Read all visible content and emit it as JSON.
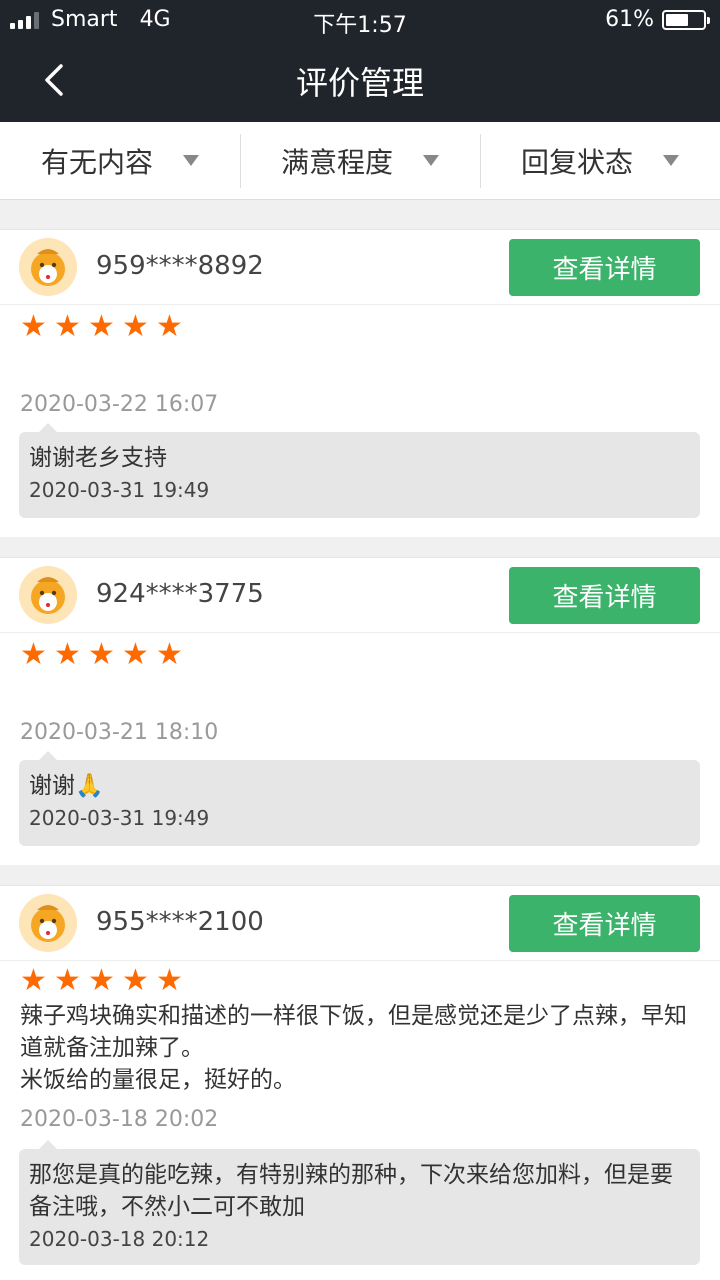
{
  "status_bar": {
    "carrier": "Smart",
    "network": "4G",
    "time": "下午1:57",
    "battery": "61%",
    "battery_level": 0.61
  },
  "nav": {
    "title": "评价管理"
  },
  "filters": [
    {
      "label": "有无内容"
    },
    {
      "label": "满意程度"
    },
    {
      "label": "回复状态"
    }
  ],
  "reviews": [
    {
      "user": "959****8892",
      "button": "查看详情",
      "stars": 5,
      "content": "",
      "date": "2020-03-22 16:07",
      "reply": {
        "text": "谢谢老乡支持",
        "date": "2020-03-31 19:49"
      }
    },
    {
      "user": "924****3775",
      "button": "查看详情",
      "stars": 5,
      "content": "",
      "date": "2020-03-21 18:10",
      "reply": {
        "text": "谢谢🙏",
        "date": "2020-03-31 19:49"
      }
    },
    {
      "user": "955****2100",
      "button": "查看详情",
      "stars": 5,
      "content": "辣子鸡块确实和描述的一样很下饭，但是感觉还是少了点辣，早知道就备注加辣了。\n米饭给的量很足，挺好的。",
      "date": "2020-03-18 20:02",
      "reply": {
        "text": "那您是真的能吃辣，有特别辣的那种，下次来给您加料，但是要备注哦，不然小二可不敢加",
        "date": "2020-03-18 20:12"
      }
    }
  ],
  "colors": {
    "header_bg": "#20242b",
    "button_green": "#3bb36b",
    "star_orange": "#ff6a00"
  }
}
